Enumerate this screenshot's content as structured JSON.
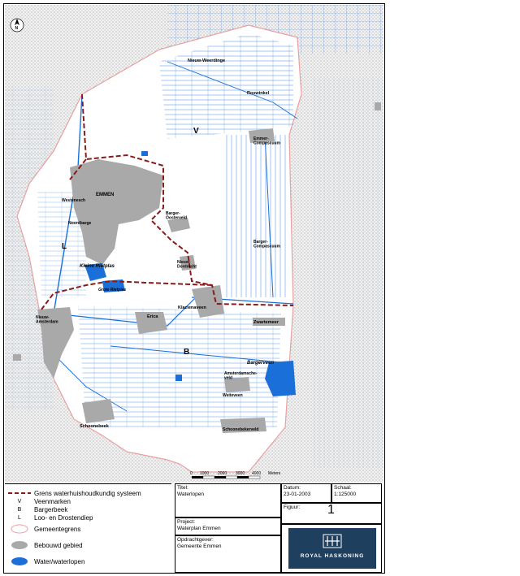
{
  "map": {
    "north_label": "N",
    "region_letters": {
      "V": "V",
      "L": "L",
      "B": "B"
    },
    "places": {
      "nieuw_weerdinge": "Nieuw-Weerdinge",
      "roswinkel": "Roswinkel",
      "emmer_compascuum": "Emmer-\nCompascuum",
      "emmen": "EMMEN",
      "westenesch": "Westenesch",
      "noordbarge": "Noordbarge",
      "barger_oosterveld": "Barger-\nOosterveld",
      "barger_compascuum": "Barger-\nCompascuum",
      "nieuw_dordrecht": "Nieuw-\nDordrecht",
      "kleine_rietplas": "Kleine Rietplas",
      "grote_rietplas": "Grote Rietplas",
      "klazienaveen": "Klazienaveen",
      "zwartemeer": "Zwartemeer",
      "nieuw_amsterdam": "Nieuw-\nAmsterdam",
      "erica": "Erica",
      "bargerveen": "Bargerveen",
      "amsterdamsche_veld": "Amsterdamsche-\nveld",
      "weiteveen": "Weiteveen",
      "schoonebeek": "Schoonebeek",
      "schoonebekerveld": "Schoonebekerveld"
    },
    "scale_ticks": [
      "0",
      "1000",
      "2000",
      "3000",
      "4000"
    ],
    "scale_unit": "Meters"
  },
  "legend": {
    "items": [
      {
        "symbol": "dash",
        "label": "Grens waterhuishoudkundig systeem"
      },
      {
        "symbol": "V",
        "label": "Veenmarken"
      },
      {
        "symbol": "B",
        "label": "Bargerbeek"
      },
      {
        "symbol": "L",
        "label": "Loo- en Drostendiep"
      },
      {
        "symbol": "outline",
        "label": "Gemeentegrens"
      },
      {
        "symbol": "grey",
        "label": "Bebouwd gebied"
      },
      {
        "symbol": "blue",
        "label": "Water/waterlopen"
      }
    ],
    "colors": {
      "boundary": "#8b1a1a",
      "built": "#a9a9a9",
      "water": "#1a6fd9",
      "municipality": "#e8a0a0"
    }
  },
  "title_block": {
    "titel_label": "Titel:",
    "titel_value": "Waterlopen",
    "datum_label": "Datum:",
    "datum_value": "23-01-2003",
    "schaal_label": "Schaal:",
    "schaal_value": "1:125000",
    "figuur_label": "Figuur:",
    "figuur_value": "1",
    "project_label": "Project:",
    "project_value": "Waterplan Emmen",
    "opdrachtgever_label": "Opdrachtgever:",
    "opdrachtgever_value": "Gemeente Emmen",
    "logo_text": "ROYAL HASKONING"
  }
}
